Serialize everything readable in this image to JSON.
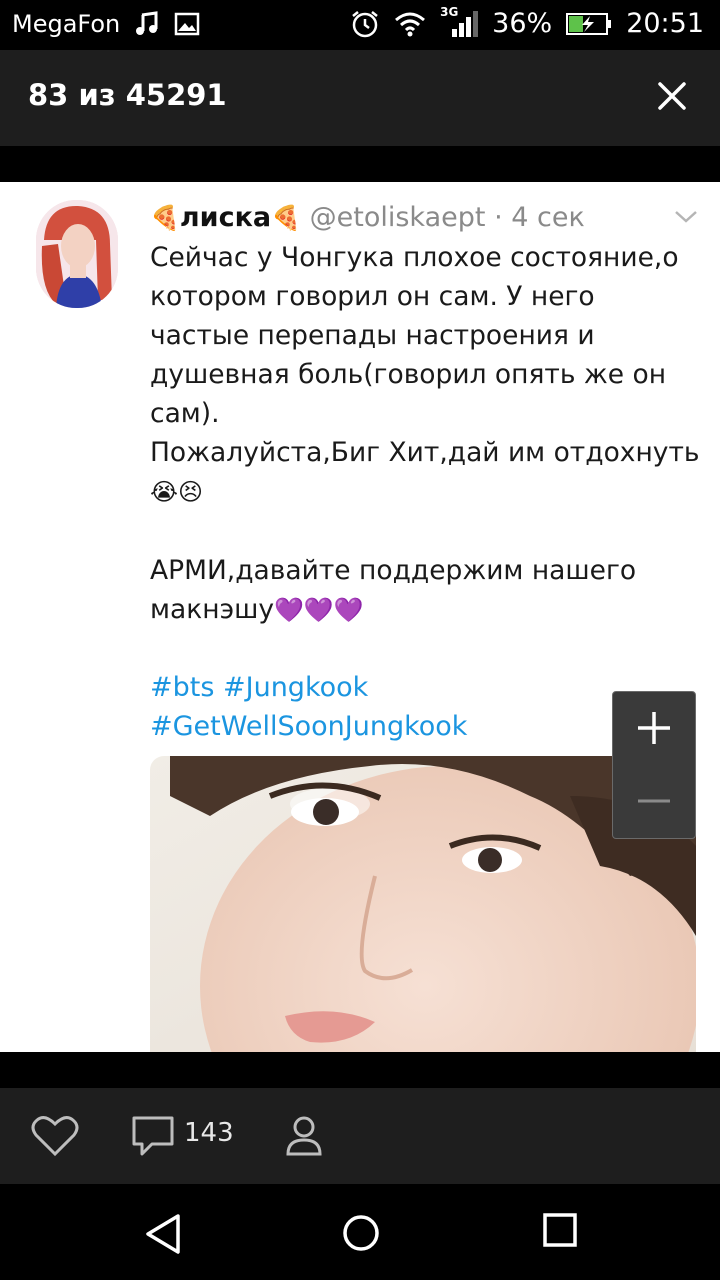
{
  "status_bar": {
    "carrier": "MegaFon",
    "network": "3G",
    "battery": "36%",
    "time": "20:51"
  },
  "header": {
    "counter": "83 из 45291"
  },
  "tweet": {
    "name": "лиска",
    "handle": "@etoliskaept",
    "separator": "·",
    "time": "4 сек",
    "text_1": "Сейчас у Чонгука плохое состояние,о\nкотором говорил он сам. У него\nчастые перепады настроения и\nдушевная боль(говорил опять же он\nсам).\nПожалуйста,Биг Хит,дай им отдохнуть",
    "emoji_1": "😭😣",
    "text_2": "АРМИ,давайте поддержим нашего\nмакнэшу",
    "emoji_2": "💜💜💜",
    "hashtags": "#bts #Jungkook\n#GetWellSoonJungkook",
    "name_emoji": "🍕"
  },
  "bottom_bar": {
    "comments_count": "143"
  },
  "colors": {
    "hashtag": "#1b95e0",
    "bar": "#1e1e1e"
  }
}
